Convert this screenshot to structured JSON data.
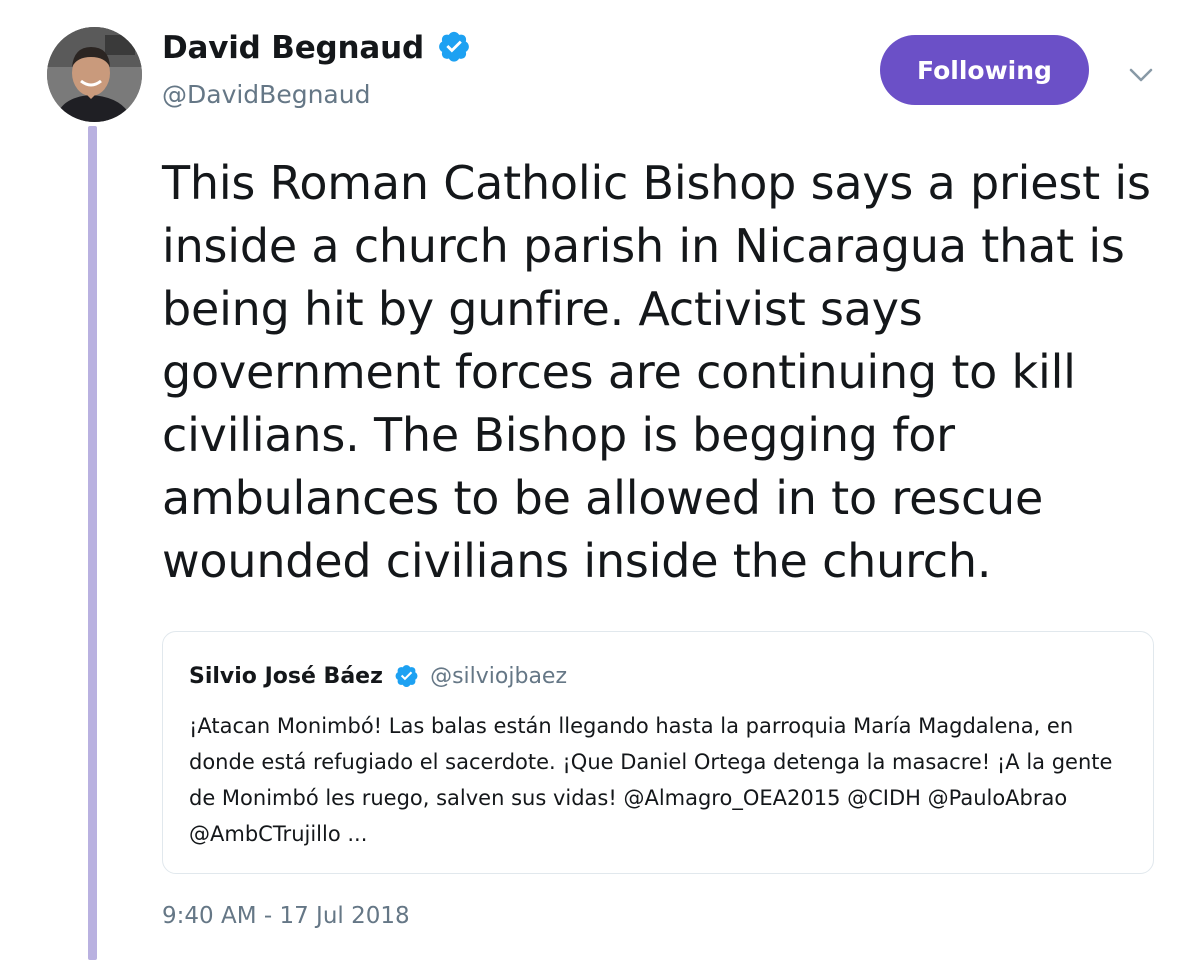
{
  "author": {
    "display_name": "David Begnaud",
    "handle": "@DavidBegnaud",
    "verified_icon": "verified-badge-icon"
  },
  "follow_button": {
    "label": "Following",
    "color": "#6b50c7"
  },
  "menu_icon": "chevron-down-icon",
  "tweet": {
    "text": "This Roman Catholic Bishop says a priest is inside a church parish in Nicaragua that is being hit by gunfire. Activist says government forces are continuing to kill civilians. The Bishop is begging for ambulances to be allowed in to rescue wounded civilians inside the church.",
    "timestamp": "9:40 AM - 17 Jul 2018"
  },
  "quoted_tweet": {
    "display_name": "Silvio José Báez",
    "handle": "@silviojbaez",
    "text": "¡Atacan Monimbó! Las balas están llegando hasta la parroquia María Magdalena, en donde está refugiado el sacerdote. ¡Que Daniel Ortega detenga la masacre! ¡A la gente de Monimbó les ruego, salven sus vidas! @Almagro_OEA2015 @CIDH @PauloAbrao @AmbCTrujillo ..."
  },
  "colors": {
    "thread_line": "#b9b1e0",
    "verified": "#1da1f2",
    "secondary_text": "#657786"
  }
}
